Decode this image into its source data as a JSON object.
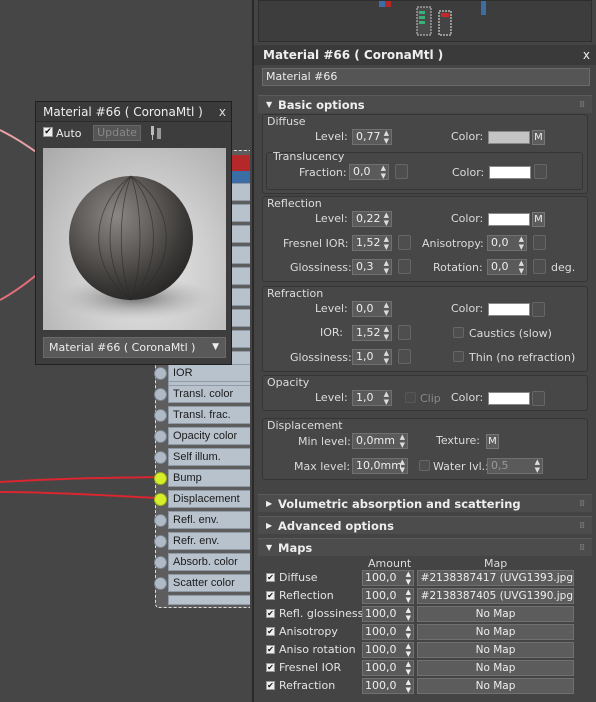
{
  "preview": {
    "title": "Material #66  ( CoronaMtl )",
    "close": "x",
    "auto_label": "Auto",
    "update_label": "Update",
    "selector": "Material #66  ( CoronaMtl )"
  },
  "node": {
    "slots": [
      "IOR",
      "Transl. color",
      "Transl. frac.",
      "Opacity color",
      "Self illum.",
      "Bump",
      "Displacement",
      "Refl. env.",
      "Refr. env.",
      "Absorb. color",
      "Scatter color"
    ],
    "active_slots": [
      "Bump",
      "Displacement"
    ]
  },
  "panel": {
    "title": "Material #66  ( CoronaMtl )",
    "close": "x",
    "name": "Material #66",
    "basic_options": "Basic options",
    "diffuse": {
      "title": "Diffuse",
      "level_label": "Level:",
      "level": "0,77",
      "color_label": "Color:",
      "m": "M",
      "color": "#c4c4c4"
    },
    "translucency": {
      "title": "Translucency",
      "fraction_label": "Fraction:",
      "fraction": "0,0",
      "color_label": "Color:",
      "color": "#ffffff"
    },
    "reflection": {
      "title": "Reflection",
      "level_label": "Level:",
      "level": "0,22",
      "color_label": "Color:",
      "m": "M",
      "color": "#ffffff",
      "fresnel_label": "Fresnel IOR:",
      "fresnel": "1,52",
      "aniso_label": "Anisotropy:",
      "aniso": "0,0",
      "gloss_label": "Glossiness:",
      "gloss": "0,3",
      "rotation_label": "Rotation:",
      "rotation": "0,0",
      "deg": "deg."
    },
    "refraction": {
      "title": "Refraction",
      "level_label": "Level:",
      "level": "0,0",
      "color_label": "Color:",
      "color": "#ffffff",
      "ior_label": "IOR:",
      "ior": "1,52",
      "caustics_label": "Caustics (slow)",
      "gloss_label": "Glossiness:",
      "gloss": "1,0",
      "thin_label": "Thin (no refraction)"
    },
    "opacity": {
      "title": "Opacity",
      "level_label": "Level:",
      "level": "1,0",
      "clip_label": "Clip",
      "color_label": "Color:",
      "color": "#ffffff"
    },
    "displacement": {
      "title": "Displacement",
      "min_label": "Min level:",
      "min": "0,0mm",
      "texture_label": "Texture:",
      "m": "M",
      "max_label": "Max level:",
      "max": "10,0mm",
      "water_label": "Water lvl.:",
      "water": "0,5"
    },
    "volumetric": "Volumetric absorption and scattering",
    "advanced": "Advanced options",
    "maps": {
      "title": "Maps",
      "amount_header": "Amount",
      "map_header": "Map",
      "rows": [
        {
          "name": "Diffuse",
          "amount": "100,0",
          "map": "Map #2138387417 (UVG1393.jpg"
        },
        {
          "name": "Reflection",
          "amount": "100,0",
          "map": "Map #2138387405 (UVG1390.jpg"
        },
        {
          "name": "Refl. glossiness",
          "amount": "100,0",
          "map": "No Map"
        },
        {
          "name": "Anisotropy",
          "amount": "100,0",
          "map": "No Map"
        },
        {
          "name": "Aniso rotation",
          "amount": "100,0",
          "map": "No Map"
        },
        {
          "name": "Fresnel IOR",
          "amount": "100,0",
          "map": "No Map"
        },
        {
          "name": "Refraction",
          "amount": "100,0",
          "map": "No Map"
        }
      ]
    }
  }
}
